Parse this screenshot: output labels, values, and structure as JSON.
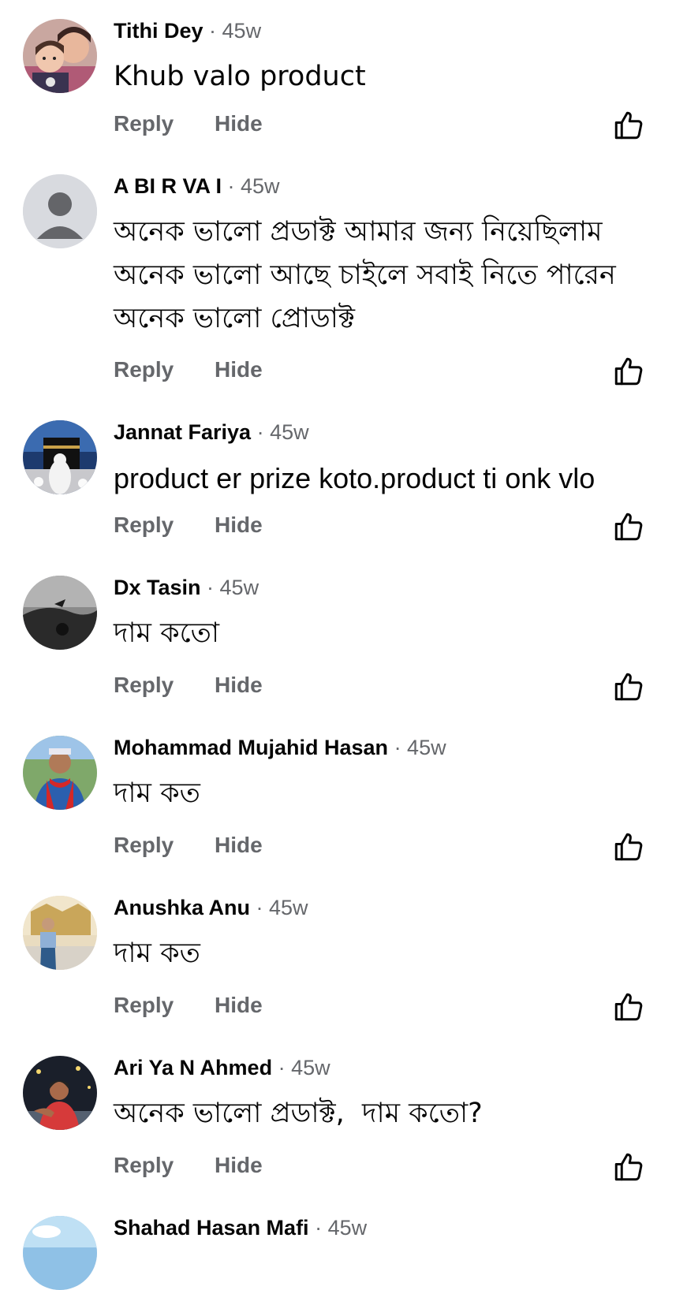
{
  "comments": [
    {
      "name": "Tithi Dey",
      "time": "· 45w",
      "text": "Khub valo product",
      "reply": "Reply",
      "hide": "Hide",
      "avatar": "avatar-mother-child-photo"
    },
    {
      "name": "A BI R VA I",
      "time": "· 45w",
      "text": "অনেক ভালো প্রডাক্ট আমার জন্য নিয়েছিলাম অনেক ভালো আছে চাইলে সবাই নিতে পারেন অনেক ভালো প্রোডাক্ট",
      "reply": "Reply",
      "hide": "Hide",
      "avatar": "default-person-avatar"
    },
    {
      "name": "Jannat Fariya",
      "time": "· 45w",
      "text": "product er prize koto.product ti onk vlo",
      "reply": "Reply",
      "hide": "Hide",
      "avatar": "avatar-kaaba-photo"
    },
    {
      "name": "Dx Tasin",
      "time": "· 45w",
      "text": "দাম কতো",
      "reply": "Reply",
      "hide": "Hide",
      "avatar": "avatar-dark-sky-photo"
    },
    {
      "name": "Mohammad Mujahid Hasan",
      "time": "· 45w",
      "text": "দাম কত",
      "reply": "Reply",
      "hide": "Hide",
      "avatar": "avatar-man-red-scarf-photo"
    },
    {
      "name": "Anushka Anu",
      "time": "· 45w",
      "text": "দাম কত",
      "reply": "Reply",
      "hide": "Hide",
      "avatar": "avatar-woman-palace-photo"
    },
    {
      "name": "Ari Ya N Ahmed",
      "time": "· 45w",
      "text": "অনেক ভালো প্রডাক্ট,  দাম কতো?",
      "reply": "Reply",
      "hide": "Hide",
      "avatar": "avatar-boy-night-photo"
    },
    {
      "name": "Shahad Hasan Mafi",
      "time": "· 45w",
      "text": "",
      "reply": "",
      "hide": "",
      "avatar": "avatar-sky-photo"
    }
  ],
  "colors": {
    "name": "#050505",
    "meta_gray": "#65676b",
    "default_avatar_bg": "#d8dadf"
  },
  "icons": {
    "like": "thumbs-up-outline-icon"
  }
}
